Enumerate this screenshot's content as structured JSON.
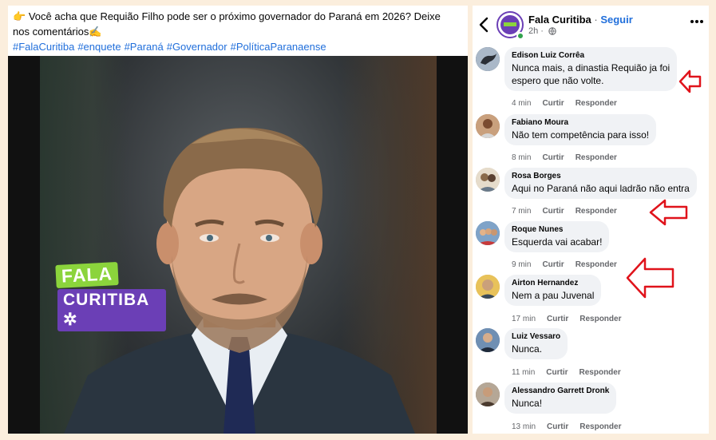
{
  "post": {
    "caption_emoji": "👉",
    "caption_text": "Você acha que Requião Filho pode ser o próximo governador do Paraná em 2026? Deixe nos comentários✍️",
    "hashtags": [
      "#FalaCuritiba",
      "#enquete",
      "#Paraná",
      "#Governador",
      "#PolíticaParanaense"
    ],
    "logo_line1": "FALA",
    "logo_line2": "CURITIBA ✲"
  },
  "header": {
    "page_name": "Fala Curitiba",
    "separator": " · ",
    "follow_label": "Seguir",
    "time": "2h ·"
  },
  "comments": [
    {
      "author": "Edison Luiz Corrêa",
      "text_lines": [
        "Nunca mais, a dinastia Requião ja foi",
        "espero que não volte."
      ],
      "time": "4 min",
      "like": "Curtir",
      "reply": "Responder",
      "avatar_color": "#3b4a5c"
    },
    {
      "author": "Fabiano Moura",
      "text_lines": [
        "Não tem competência para isso!"
      ],
      "time": "8 min",
      "like": "Curtir",
      "reply": "Responder",
      "avatar_color": "#9c6a4a"
    },
    {
      "author": "Rosa Borges",
      "text_lines": [
        "Aqui no Paraná  não aqui ladrão não entra"
      ],
      "time": "7 min",
      "like": "Curtir",
      "reply": "Responder",
      "avatar_color": "#c8b49a"
    },
    {
      "author": "Roque Nunes",
      "text_lines": [
        "Esquerda vai acabar!"
      ],
      "time": "9 min",
      "like": "Curtir",
      "reply": "Responder",
      "avatar_color": "#5a7fa8"
    },
    {
      "author": "Airton Hernandez",
      "text_lines": [
        "Nem a pau Juvenal"
      ],
      "time": "17 min",
      "like": "Curtir",
      "reply": "Responder",
      "avatar_color": "#d4a93a"
    },
    {
      "author": "Luiz Vessaro",
      "text_lines": [
        "Nunca."
      ],
      "time": "11 min",
      "like": "Curtir",
      "reply": "Responder",
      "avatar_color": "#4d6f96"
    },
    {
      "author": "Alessandro Garrett Dronk",
      "text_lines": [
        "Nunca!"
      ],
      "time": "13 min",
      "like": "Curtir",
      "reply": "Responder",
      "avatar_color": "#7a6a5a"
    }
  ],
  "colors": {
    "accent": "#216fdb",
    "brand_purple": "#6b3fb6",
    "brand_green": "#8bd43c",
    "arrow_red": "#e0131b",
    "page_bg": "#fbeedd"
  }
}
